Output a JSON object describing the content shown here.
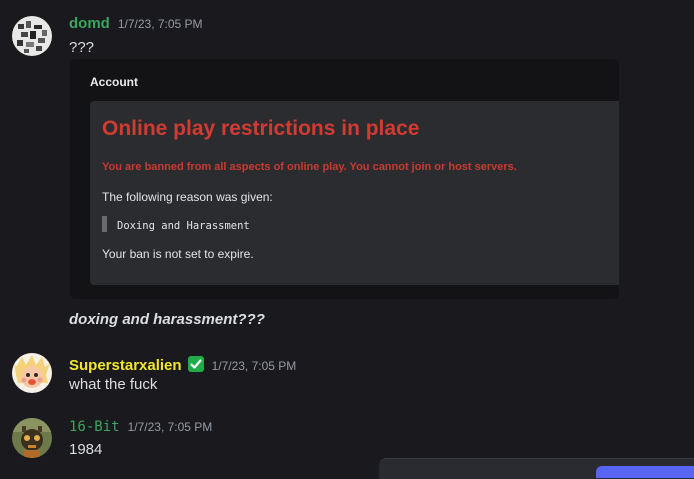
{
  "messages": [
    {
      "username": "domd",
      "username_color": "#3ba55d",
      "timestamp": "1/7/23, 7:05 PM",
      "text": "???",
      "embed": {
        "section_title": "Account",
        "headline": "Online play restrictions in place",
        "ban_notice": "You are banned from all aspects of online play. You cannot join or host servers.",
        "reason_label": "The following reason was given:",
        "reason": "Doxing and Harassment",
        "expiry": "Your ban is not set to expire."
      },
      "followup_text": "doxing and harassment???"
    },
    {
      "username": "Superstarxalien",
      "username_color": "#f1e62a",
      "badge": "checkmark-icon",
      "timestamp": "1/7/23, 7:05 PM",
      "text": "what the fuck"
    },
    {
      "username": "16-Bit",
      "username_color": "#3ba55d",
      "timestamp": "1/7/23, 7:05 PM",
      "text": "1984"
    }
  ]
}
